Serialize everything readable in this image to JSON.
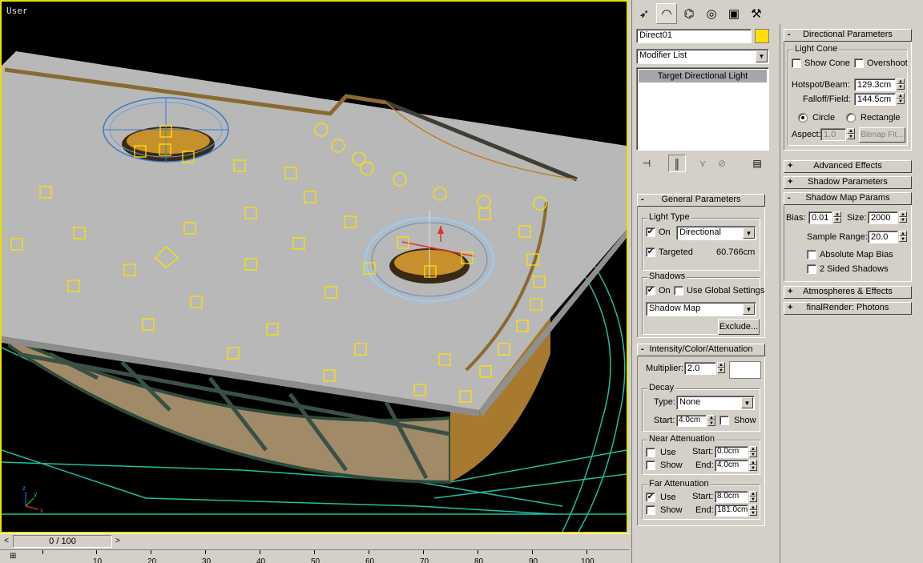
{
  "viewport": {
    "label": "User"
  },
  "timeline": {
    "position": "0 / 100",
    "prev": "<",
    "next": ">"
  },
  "ruler": {
    "ticks": [
      "10",
      "20",
      "30",
      "40",
      "50",
      "60",
      "70",
      "80",
      "90",
      "100"
    ]
  },
  "tabs": [
    {
      "icon": "create-icon",
      "glyph": "➶"
    },
    {
      "icon": "modify-icon",
      "glyph": "◠"
    },
    {
      "icon": "hierarchy-icon",
      "glyph": "⌬"
    },
    {
      "icon": "motion-icon",
      "glyph": "◎"
    },
    {
      "icon": "display-icon",
      "glyph": "▣"
    },
    {
      "icon": "utilities-icon",
      "glyph": "⚒"
    }
  ],
  "object": {
    "name": "Direct01",
    "color": "#ffe000"
  },
  "modifier_list": {
    "label": "Modifier List",
    "stack_item": "Target Directional Light"
  },
  "general": {
    "title": "General Parameters",
    "light_type_label": "Light Type",
    "on_label": "On",
    "type_value": "Directional",
    "targeted_label": "Targeted",
    "targeted_dist": "60.766cm",
    "shadows_label": "Shadows",
    "shadow_on_label": "On",
    "global_label": "Use Global Settings",
    "shadow_type": "Shadow Map",
    "exclude_label": "Exclude..."
  },
  "intensity": {
    "title": "Intensity/Color/Attenuation",
    "multiplier_label": "Multiplier:",
    "multiplier_value": "2.0",
    "color": "#ffffff",
    "decay_label": "Decay",
    "type_label": "Type:",
    "type_value": "None",
    "start_label": "Start:",
    "start_value": "4.0cm",
    "show_label": "Show",
    "near_label": "Near Attenuation",
    "near_use": "Use",
    "near_show": "Show",
    "near_start_label": "Start:",
    "near_start": "0.0cm",
    "near_end_label": "End:",
    "near_end": "4.0cm",
    "far_label": "Far Attenuation",
    "far_use": "Use",
    "far_show": "Show",
    "far_start_label": "Start:",
    "far_start": "8.0cm",
    "far_end_label": "End:",
    "far_end": "181.0cm"
  },
  "directional": {
    "title": "Directional Parameters",
    "cone_label": "Light Cone",
    "show_cone": "Show Cone",
    "overshoot": "Overshoot",
    "hotspot_label": "Hotspot/Beam:",
    "hotspot_value": "129.3cm",
    "falloff_label": "Falloff/Field:",
    "falloff_value": "144.5cm",
    "circle_label": "Circle",
    "rectangle_label": "Rectangle",
    "aspect_label": "Aspect:",
    "aspect_value": "1.0",
    "bitmap_fit": "Bitmap Fit..."
  },
  "collapsed": {
    "advanced": "Advanced Effects",
    "shadow_params": "Shadow Parameters"
  },
  "shadow_map": {
    "title": "Shadow Map Params",
    "bias_label": "Bias:",
    "bias_value": "0.01",
    "size_label": "Size:",
    "size_value": "2000",
    "range_label": "Sample Range:",
    "range_value": "20.0",
    "abs_bias": "Absolute Map Bias",
    "two_sided": "2 Sided Shadows"
  },
  "more": {
    "atmos": "Atmospheres & Effects",
    "final_render": "finalRender: Photons"
  }
}
